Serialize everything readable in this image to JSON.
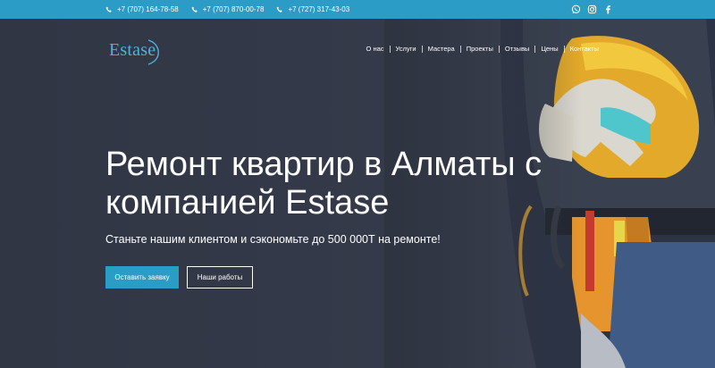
{
  "topbar": {
    "phones": [
      "+7 (707) 164-78-58",
      "+7 (707) 870-00-78",
      "+7 (727) 317-43-03"
    ],
    "social_icons": [
      "whatsapp-icon",
      "instagram-icon",
      "facebook-icon"
    ]
  },
  "header": {
    "logo_text": "Estase",
    "nav": [
      "О нас",
      "Услуги",
      "Мастера",
      "Проекты",
      "Отзывы",
      "Цены",
      "Контакты"
    ]
  },
  "hero": {
    "title": "Ремонт квартир в Алматы с компанией Estase",
    "subtitle": "Станьте нашим клиентом и сэкономьте до 500 000Т на ремонте!",
    "primary_button": "Оставить заявку",
    "secondary_button": "Наши работы"
  },
  "colors": {
    "accent": "#2a9cc6",
    "hero_background": "#303644",
    "text": "#ffffff"
  }
}
